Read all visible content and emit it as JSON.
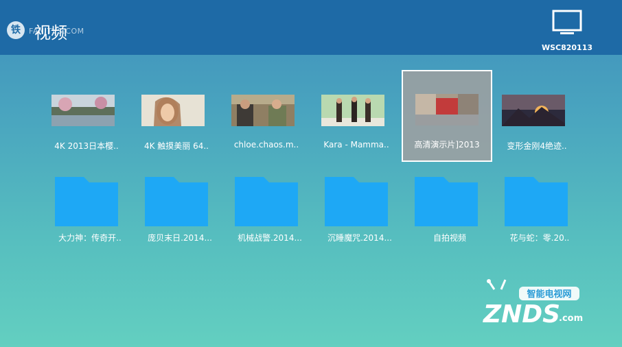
{
  "header": {
    "title": "视频",
    "logo_glyph": "铁",
    "watermark": "FAN TVS.COM",
    "device_name": "WSC820113",
    "device_icon": "monitor-icon"
  },
  "videos": [
    {
      "label": "4K 2013日本樱..",
      "thumb": "river-landscape"
    },
    {
      "label": "4K 触摸美丽 64..",
      "thumb": "woman-portrait"
    },
    {
      "label": "chloe.chaos.m..",
      "thumb": "two-people-sofa"
    },
    {
      "label": "Kara - Mamma..",
      "thumb": "dancers-stage"
    },
    {
      "label": "高清演示片]2013",
      "thumb": "street-scene"
    },
    {
      "label": "变形金刚4绝迹..",
      "thumb": "sunset-mountains"
    }
  ],
  "folders": [
    {
      "label": "大力神：传奇开.."
    },
    {
      "label": "庞贝末日.2014..."
    },
    {
      "label": "机械战警.2014..."
    },
    {
      "label": "沉睡魔咒.2014..."
    },
    {
      "label": "自拍视频"
    },
    {
      "label": "花与蛇：零.20.."
    }
  ],
  "branding": {
    "znds_cn": "智能电视网",
    "znds_text": "ZNDS",
    "znds_suffix": ".com"
  },
  "colors": {
    "header": "#1e6aa6",
    "folder": "#1ea8f5",
    "selected_tile": "#a0a0a0"
  }
}
